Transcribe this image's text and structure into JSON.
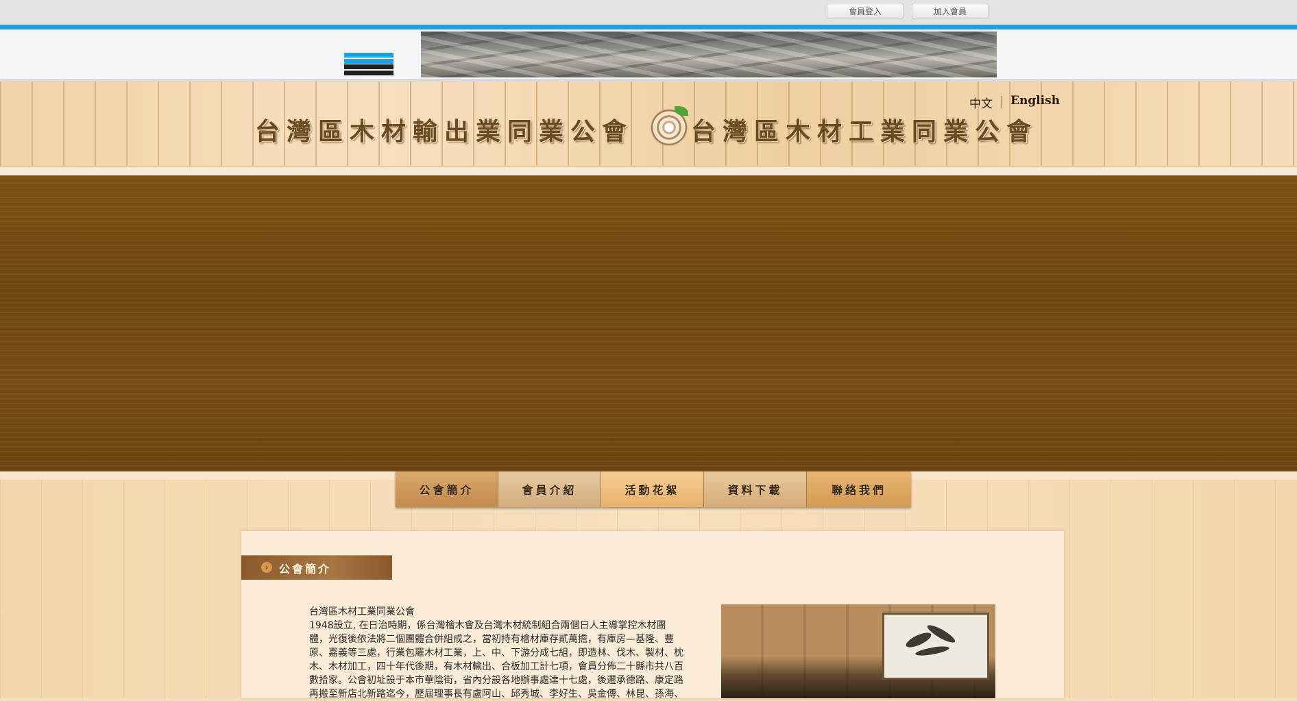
{
  "topbar": {
    "login_label": "會員登入",
    "join_label": "加入會員"
  },
  "header": {
    "lang_zh": "中文",
    "lang_en": "English",
    "title_left": "台灣區木材輸出業同業公會",
    "title_right": "台灣區木材工業同業公會"
  },
  "nav": {
    "items": [
      "公會簡介",
      "會員介紹",
      "活動花絮",
      "資料下載",
      "聯絡我們"
    ]
  },
  "section": {
    "title": "公會簡介"
  },
  "article": {
    "heading": "台灣區木材工業同業公會",
    "lines": [
      "1948設立, 在日治時期，係台灣檜木會及台灣木材統制組合兩個日人主導掌控木材團",
      "體，光復後依法將二個團體合併組成之，當初持有檜材庫存貳萬擔，有庫房—基隆、豐",
      "原、嘉義等三處，行業包羅木材工業，上、中、下游分成七組，即造林、伐木、製材、枕",
      "木、木材加工，四十年代後期，有木材輸出、合板加工計七項，會員分佈二十縣市共八百",
      "數拾家。公會初址設于本市華陰街，省內分設各地辦事處達十七處，後遷承德路、康定路",
      "再搬至新店北新路迄今，歷屆理事長有盧阿山、邱秀城、李好生、吳金傳、林昆、孫海、"
    ]
  },
  "colors": {
    "accent_blue": "#1aa3e0",
    "hero_brown": "#6e4610",
    "title_brown": "#6b4a22"
  }
}
